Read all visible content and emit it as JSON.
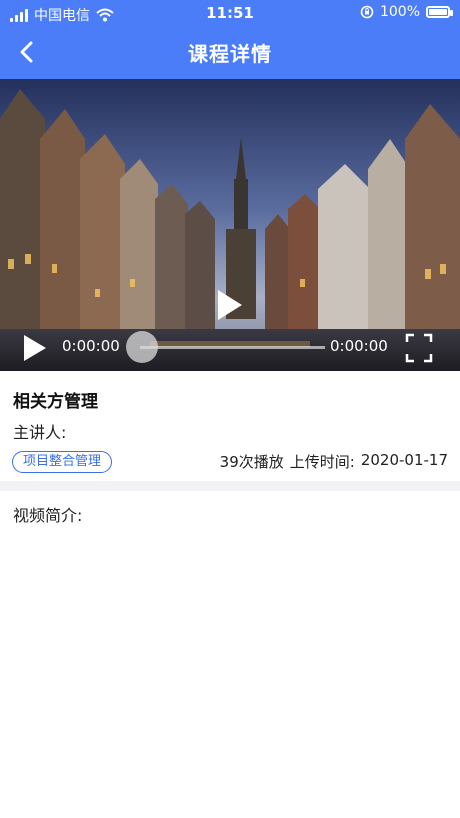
{
  "status_bar": {
    "carrier": "中国电信",
    "time": "11:51",
    "battery_text": "100%"
  },
  "nav": {
    "title": "课程详情"
  },
  "player": {
    "current_time": "0:00:00",
    "duration": "0:00:00",
    "progress": 0
  },
  "course": {
    "title": "相关方管理",
    "lecturer_label": "主讲人:",
    "tag": "项目整合管理",
    "play_count": "39次播放",
    "upload_time_label": "上传时间:",
    "upload_date": "2020-01-17"
  },
  "intro": {
    "label": "视频简介:"
  },
  "colors": {
    "header_bg": "#4a7df7",
    "accent": "#3a6fe8"
  }
}
